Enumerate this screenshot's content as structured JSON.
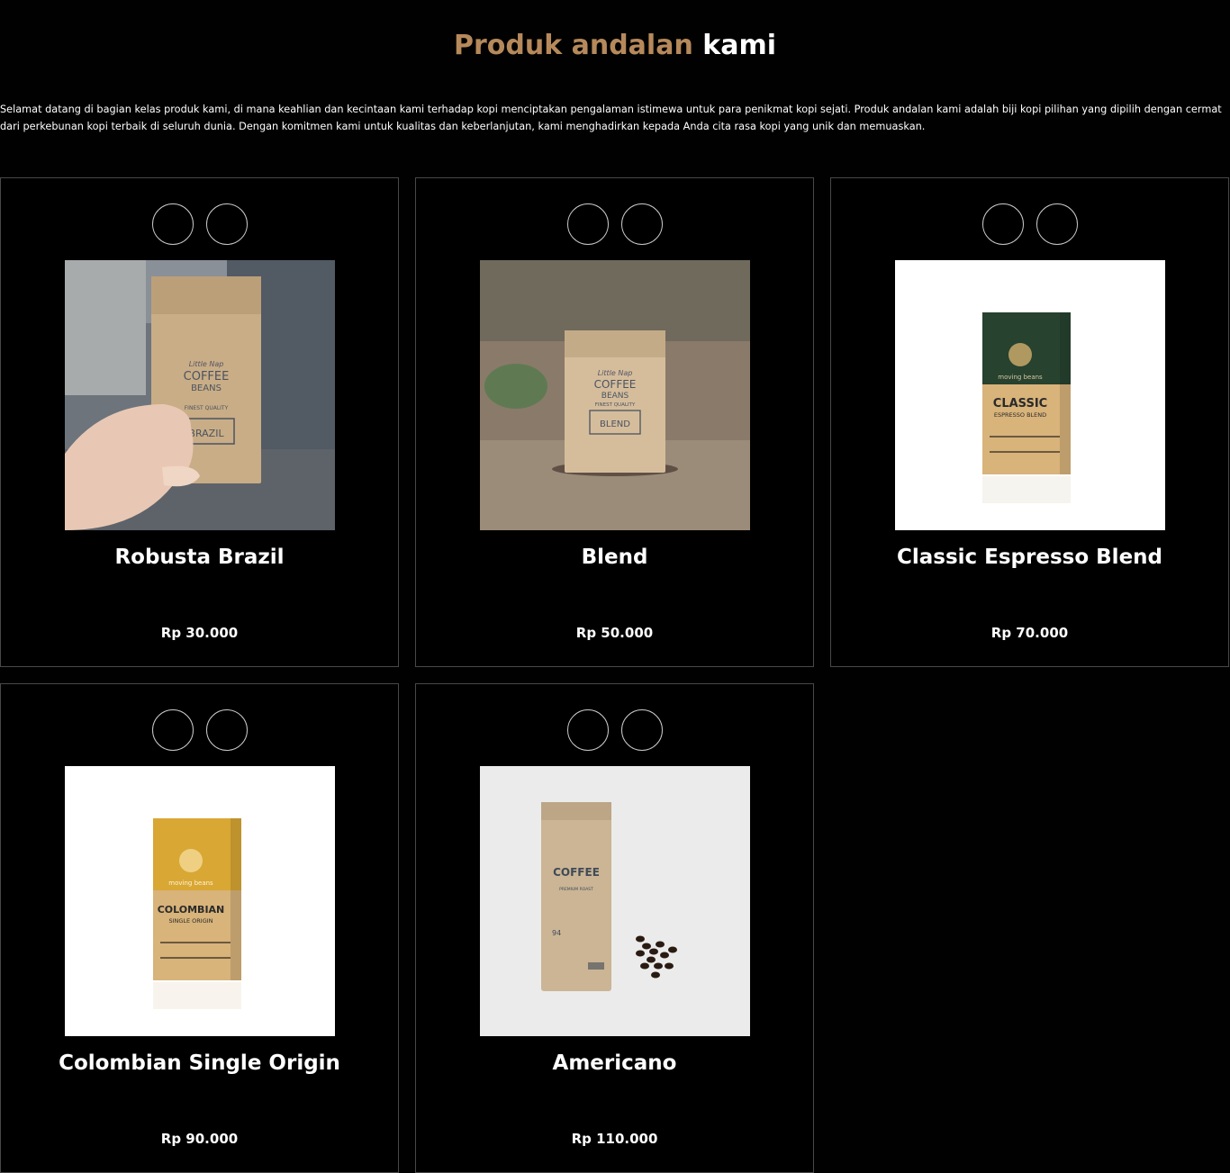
{
  "heading": {
    "accent": "Produk andalan",
    "rest": "kami"
  },
  "intro": "Selamat datang di bagian kelas produk kami, di mana keahlian dan kecintaan kami terhadap kopi menciptakan pengalaman istimewa untuk para penikmat kopi sejati. Produk andalan kami adalah biji kopi pilihan yang dipilih dengan cermat dari perkebunan kopi terbaik di seluruh dunia. Dengan komitmen kami untuk kualitas dan keberlanjutan, kami menghadirkan kepada Anda cita rasa kopi yang unik dan memuaskan.",
  "colors": {
    "accent": "#b6895b",
    "background": "#010101",
    "card_border": "#484848"
  },
  "products": [
    {
      "name": "Robusta Brazil",
      "price": "Rp 30.000",
      "image": "photo-hand-holding-brazil-bag",
      "bag_text": {
        "brand": "Little Nap",
        "line1": "COFFEE",
        "line2": "BEANS",
        "quality": "FINEST QUALITY",
        "label": "BRAZIL"
      }
    },
    {
      "name": "Blend",
      "price": "Rp 50.000",
      "image": "photo-bag-on-soil",
      "bag_text": {
        "brand": "Little Nap",
        "line1": "COFFEE",
        "line2": "BEANS",
        "quality": "FINEST QUALITY",
        "label": "BLEND"
      }
    },
    {
      "name": "Classic Espresso Blend",
      "price": "Rp 70.000",
      "image": "green-box-classic",
      "bag_text": {
        "brand": "moving beans",
        "line1": "CLASSIC",
        "line2": "ESPRESSO BLEND"
      }
    },
    {
      "name": "Colombian Single Origin",
      "price": "Rp 90.000",
      "image": "yellow-box-colombian",
      "bag_text": {
        "brand": "moving beans",
        "line1": "COLOMBIAN",
        "line2": "SINGLE ORIGIN"
      }
    },
    {
      "name": "Americano",
      "price": "Rp 110.000",
      "image": "kraft-bag-with-beans",
      "bag_text": {
        "line1": "COFFEE",
        "line2": "PREMIUM ROAST",
        "number": "94"
      }
    }
  ]
}
